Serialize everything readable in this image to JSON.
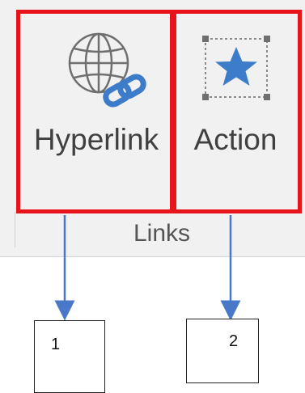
{
  "ribbon": {
    "group_label": "Links",
    "buttons": [
      {
        "label": "Hyperlink",
        "icon": "globe-link-icon"
      },
      {
        "label": "Action",
        "icon": "star-action-icon"
      }
    ]
  },
  "callouts": [
    {
      "number": "1"
    },
    {
      "number": "2"
    }
  ],
  "colors": {
    "highlight": "#e8141c",
    "arrow": "#4a78c8",
    "icon_blue": "#3d7cc9",
    "icon_gray": "#6f6f6f",
    "ribbon_bg": "#f1f1f1"
  }
}
